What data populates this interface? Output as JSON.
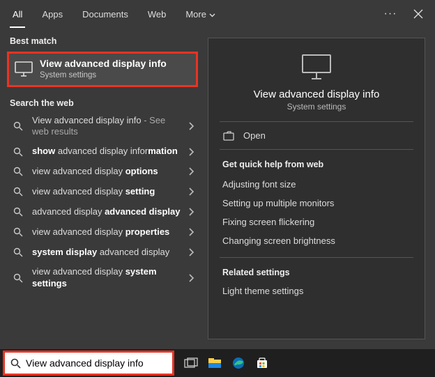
{
  "tabs": {
    "all": "All",
    "apps": "Apps",
    "documents": "Documents",
    "web": "Web",
    "more": "More"
  },
  "left": {
    "best_match_label": "Best match",
    "bm_title": "View advanced display info",
    "bm_sub": "System settings",
    "search_web_label": "Search the web",
    "items": [
      {
        "html": "View advanced display info <span class='grey'>- See web results</span>"
      },
      {
        "html": "<b>show</b> advanced display infor<b>mation</b>"
      },
      {
        "html": "view advanced display <b>options</b>"
      },
      {
        "html": "view advanced display <b>setting</b>"
      },
      {
        "html": "advanced display <b>advanced display</b>"
      },
      {
        "html": "view advanced display <b>properties</b>"
      },
      {
        "html": "<b>system display</b> advanced display"
      },
      {
        "html": "view advanced display <b>system settings</b>"
      }
    ]
  },
  "preview": {
    "title": "View advanced display info",
    "sub": "System settings",
    "open": "Open",
    "quick_help_label": "Get quick help from web",
    "help": [
      "Adjusting font size",
      "Setting up multiple monitors",
      "Fixing screen flickering",
      "Changing screen brightness"
    ],
    "related_label": "Related settings",
    "related": [
      "Light theme settings"
    ]
  },
  "taskbar": {
    "search_value": "View advanced display info"
  }
}
